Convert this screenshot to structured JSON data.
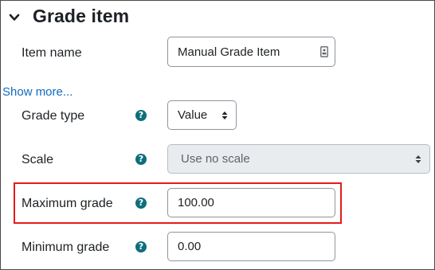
{
  "section": {
    "title": "Grade item"
  },
  "item_name": {
    "label": "Item name",
    "value": "Manual Grade Item"
  },
  "show_more": "Show more...",
  "grade_type": {
    "label": "Grade type",
    "value": "Value"
  },
  "scale": {
    "label": "Scale",
    "value": "Use no scale"
  },
  "maximum_grade": {
    "label": "Maximum grade",
    "value": "100.00"
  },
  "minimum_grade": {
    "label": "Minimum grade",
    "value": "0.00"
  },
  "help_glyph": "?",
  "colors": {
    "help_icon": "#0f6e7c",
    "link": "#0f6cbf",
    "highlight_box": "#e41b1b"
  },
  "icons": [
    "chevron-down-icon",
    "help-icon",
    "contact-card-icon",
    "select-arrows-icon"
  ]
}
